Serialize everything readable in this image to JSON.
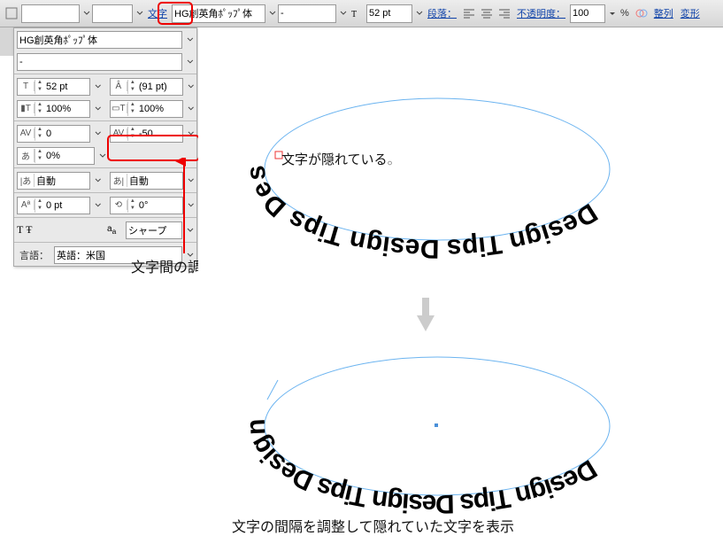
{
  "toolbar": {
    "char_label": "文字",
    "font_family": "HG創英角ﾎﾟｯﾌﾟ体",
    "font_style": "-",
    "font_size": "52 pt",
    "paragraph_label": "段落：",
    "opacity_label": "不透明度：",
    "opacity_value": "100",
    "opacity_unit": "%",
    "align_label": "整列",
    "transform_label": "変形"
  },
  "panel": {
    "font_family": "HG創英角ﾎﾟｯﾌﾟ体",
    "font_style": "-",
    "font_size": "52 pt",
    "leading": "(91 pt)",
    "vscale": "100%",
    "hscale": "100%",
    "kern": "0",
    "tracking": "-50",
    "tsume": "0%",
    "akil": "自動",
    "akir": "自動",
    "baseline": "0 pt",
    "rotation": "0°",
    "aa": "シャープ",
    "lang_label": "言語：",
    "lang_value": "英語：米国"
  },
  "annotations": {
    "tracking_note": "文字間の調整",
    "hidden_note": "文字が隠れている",
    "result_note": "文字の間隔を調整して隠れていた文字を表示"
  },
  "pathtext": "Design Tips Design Tips Design Tips Design"
}
